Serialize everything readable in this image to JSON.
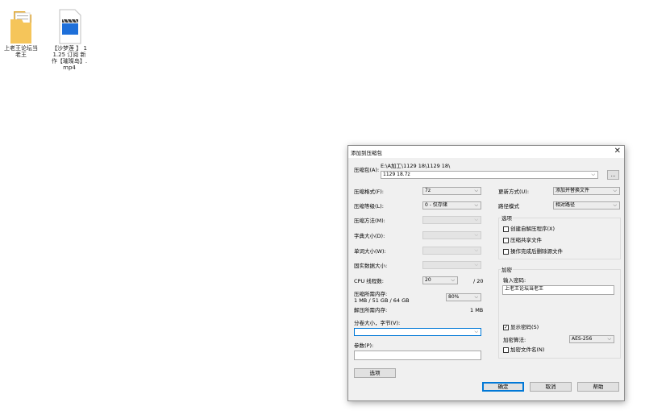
{
  "desktop": {
    "icons": [
      {
        "label": "上老王论坛当老王",
        "icon": "folder-icon"
      },
      {
        "label": "【沙梦莲 】 11.25 订阅 新作【璀璨岛】.mp4",
        "icon": "video-file-icon"
      }
    ]
  },
  "dialog": {
    "title": "添加到压缩包",
    "archive_label": "压缩包(A):",
    "archive_path": "E:\\A加工\\1129 18\\1129 18\\",
    "archive_name": "1129 18.7z",
    "browse_label": "...",
    "format_label": "压缩格式(F):",
    "format_value": "7z",
    "level_label": "压缩等级(L):",
    "level_value": "0 - 仅存储",
    "method_label": "压缩方法(M):",
    "dict_label": "字典大小(D):",
    "word_label": "单词大小(W):",
    "solid_label": "固实数据大小:",
    "cpu_label": "CPU 线程数:",
    "cpu_value": "20",
    "cpu_total": "/ 20",
    "mem_comp_label": "压缩所需内存:",
    "mem_comp_value": "1 MB / 51 GB / 64 GB",
    "mem_pct_value": "80%",
    "mem_decomp_label": "解压所需内存:",
    "mem_decomp_value": "1 MB",
    "split_label": "分卷大小，字节(V):",
    "params_label": "参数(P):",
    "options_button": "选项",
    "update_label": "更新方式(U):",
    "update_value": "添加并替换文件",
    "path_label": "路径模式",
    "path_value": "相对路径",
    "options_group": {
      "title": "选项",
      "items": [
        {
          "label": "创建自解压程序(X)",
          "checked": false
        },
        {
          "label": "压缩共享文件",
          "checked": false
        },
        {
          "label": "操作完成后删除源文件",
          "checked": false
        }
      ]
    },
    "encryption": {
      "title": "加密",
      "password_label": "输入密码:",
      "password_value": "上老王论坛当老王",
      "show_password_label": "显示密码(S)",
      "show_password_checked": true,
      "method_label": "加密算法:",
      "method_value": "AES-256",
      "encrypt_names_label": "加密文件名(N)",
      "encrypt_names_checked": false
    },
    "buttons": {
      "ok": "确定",
      "cancel": "取消",
      "help": "帮助"
    }
  }
}
